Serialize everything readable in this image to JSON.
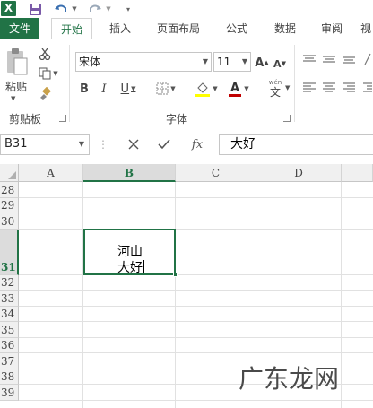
{
  "quick_access": {
    "logo_letter": "X",
    "save_icon": "save-icon",
    "undo_icon": "undo-icon",
    "redo_icon": "redo-icon",
    "customize_icon": "customize-qat-icon"
  },
  "tabs": [
    {
      "label": "文件",
      "active": false
    },
    {
      "label": "开始",
      "active": true
    },
    {
      "label": "插入",
      "active": false
    },
    {
      "label": "页面布局",
      "active": false
    },
    {
      "label": "公式",
      "active": false
    },
    {
      "label": "数据",
      "active": false
    },
    {
      "label": "审阅",
      "active": false
    },
    {
      "label": "视",
      "active": false
    }
  ],
  "ribbon": {
    "clipboard": {
      "label": "剪贴板",
      "paste_label": "粘贴"
    },
    "font": {
      "label": "字体",
      "font_name": "宋体",
      "font_size": "11",
      "wen_label": "wén",
      "wen_char": "文"
    },
    "colors": {
      "accent": "#217346",
      "font_color": "#c00000",
      "fill_color": "#ffff00"
    }
  },
  "formula_bar": {
    "name_box": "B31",
    "fx_label": "fx",
    "content": "大好"
  },
  "sheet": {
    "columns": [
      "A",
      "B",
      "C",
      "D"
    ],
    "selected_column": "B",
    "rows": [
      "28",
      "29",
      "30",
      "31",
      "32",
      "33",
      "34",
      "35",
      "36",
      "37",
      "38",
      "39"
    ],
    "selected_row": "31",
    "active_cell": {
      "ref": "B31",
      "line1": "河山",
      "line2": "大好"
    }
  },
  "watermark": "广东龙网"
}
